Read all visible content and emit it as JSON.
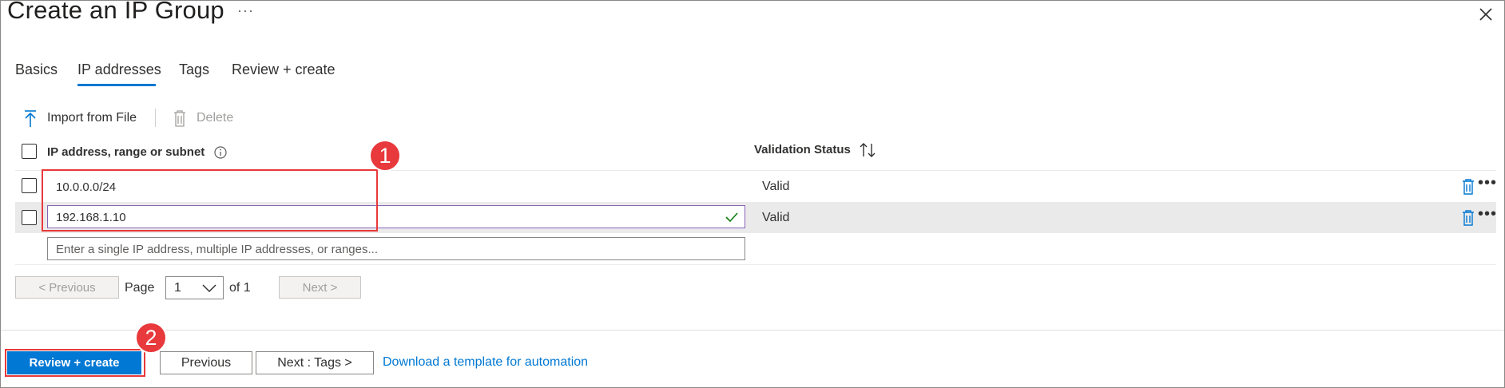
{
  "header": {
    "title": "Create an IP Group",
    "more_label": "···",
    "close_label": "×"
  },
  "tabs": [
    {
      "label": "Basics"
    },
    {
      "label": "IP addresses",
      "active": true
    },
    {
      "label": "Tags"
    },
    {
      "label": "Review + create"
    }
  ],
  "toolbar": {
    "import_label": "Import from File",
    "delete_label": "Delete"
  },
  "table": {
    "col_ip": "IP address, range or subnet",
    "col_status": "Validation Status",
    "rows": [
      {
        "ip": "10.0.0.0/24",
        "status": "Valid"
      },
      {
        "ip": "192.168.1.10",
        "status": "Valid"
      }
    ],
    "new_placeholder": "Enter a single IP address, multiple IP addresses, or ranges..."
  },
  "pagination": {
    "prev_label": "< Previous",
    "page_label": "Page",
    "page_value": "1",
    "of_label": "of 1",
    "next_label": "Next >"
  },
  "footer": {
    "review_label": "Review + create",
    "previous_label": "Previous",
    "next_label": "Next : Tags >",
    "download_link": "Download a template for automation"
  },
  "callouts": {
    "marker1": "1",
    "marker2": "2"
  },
  "colors": {
    "accent": "#0078d4",
    "callout": "#e8393c",
    "valid_check": "#107c10",
    "selected_border": "#8764b8"
  }
}
